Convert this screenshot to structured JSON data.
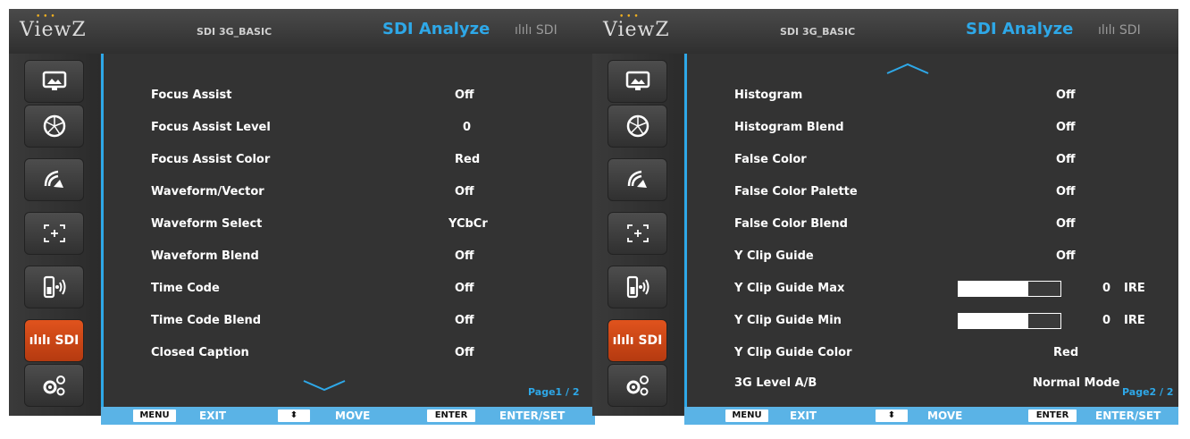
{
  "panels": [
    {
      "logo": "ViewZ",
      "subtitle": "SDI 3G_BASIC",
      "title": "SDI Analyze",
      "mode_badge": "ılılı SDI",
      "sidebar": [
        {
          "icon": "picture-icon"
        },
        {
          "icon": "color-wheel-icon"
        },
        {
          "icon": "audio-icon"
        },
        {
          "icon": "marker-icon"
        },
        {
          "icon": "remote-icon"
        },
        {
          "icon": "sdi-icon",
          "label": "ılılı SDI",
          "active": true
        },
        {
          "icon": "settings-icon"
        }
      ],
      "rows": [
        {
          "label": "Focus Assist",
          "value": "Off"
        },
        {
          "label": "Focus Assist Level",
          "value": "0"
        },
        {
          "label": "Focus Assist Color",
          "value": "Red"
        },
        {
          "label": "Waveform/Vector",
          "value": "Off"
        },
        {
          "label": "Waveform Select",
          "value": "YCbCr"
        },
        {
          "label": "Waveform Blend",
          "value": "Off"
        },
        {
          "label": "Time Code",
          "value": "Off"
        },
        {
          "label": "Time Code Blend",
          "value": "Off"
        },
        {
          "label": "Closed Caption",
          "value": "Off"
        }
      ],
      "scroll": "down",
      "page_indicator": "Page1 / 2",
      "footer": {
        "menu_key": "MENU",
        "exit": "EXIT",
        "move_key": "⬍",
        "move": "MOVE",
        "enter_key": "ENTER",
        "enter_set": "ENTER/SET"
      }
    },
    {
      "logo": "ViewZ",
      "subtitle": "SDI 3G_BASIC",
      "title": "SDI Analyze",
      "mode_badge": "ılılı SDI",
      "rows": [
        {
          "label": "Histogram",
          "value": "Off"
        },
        {
          "label": "Histogram Blend",
          "value": "Off"
        },
        {
          "label": "False Color",
          "value": "Off"
        },
        {
          "label": "False Color Palette",
          "value": "Off"
        },
        {
          "label": "False Color Blend",
          "value": "Off"
        },
        {
          "label": "Y Clip Guide",
          "value": "Off"
        },
        {
          "label": "Y Clip Guide Max",
          "bar_fraction": 0.68,
          "num": "0",
          "unit": "IRE"
        },
        {
          "label": "Y Clip Guide Min",
          "bar_fraction": 0.68,
          "num": "0",
          "unit": "IRE"
        },
        {
          "label": "Y Clip Guide Color",
          "value": "Red"
        },
        {
          "label": "3G Level A/B",
          "value": "Normal Mode"
        }
      ],
      "scroll": "up",
      "page_indicator": "Page2 / 2",
      "footer": {
        "menu_key": "MENU",
        "exit": "EXIT",
        "move_key": "⬍",
        "move": "MOVE",
        "enter_key": "ENTER",
        "enter_set": "ENTER/SET"
      }
    }
  ],
  "colors": {
    "accent": "#2ea8e8",
    "active_tab": "#d24a17",
    "panel_bg": "#333333",
    "footer_bg": "#5ab3e6"
  }
}
